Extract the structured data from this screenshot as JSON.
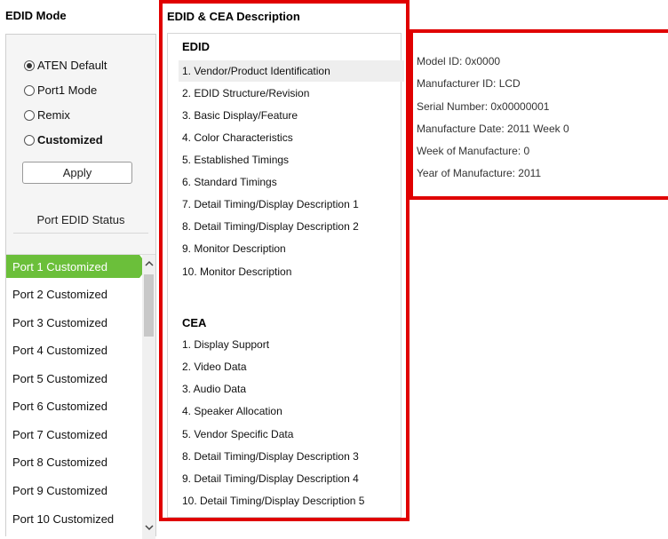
{
  "left": {
    "title": "EDID Mode",
    "modes": [
      {
        "label": "ATEN Default",
        "checked": true,
        "bold": false
      },
      {
        "label": "Port1 Mode",
        "checked": false,
        "bold": false
      },
      {
        "label": "Remix",
        "checked": false,
        "bold": false
      },
      {
        "label": "Customized",
        "checked": false,
        "bold": true
      }
    ],
    "apply_label": "Apply",
    "port_status_title": "Port EDID Status",
    "ports": [
      "Port 1  Customized",
      "Port 2  Customized",
      "Port 3  Customized",
      "Port 4  Customized",
      "Port 5  Customized",
      "Port 6  Customized",
      "Port 7  Customized",
      "Port 8  Customized",
      "Port 9  Customized",
      "Port 10  Customized"
    ],
    "active_port": 0
  },
  "middle": {
    "title": "EDID & CEA Description",
    "edid_heading": "EDID",
    "edid_items": [
      "1.  Vendor/Product Identification",
      "2.  EDID Structure/Revision",
      "3.  Basic Display/Feature",
      "4.  Color Characteristics",
      "5.  Established Timings",
      "6.  Standard Timings",
      "7.  Detail Timing/Display Description 1",
      "8.  Detail Timing/Display Description 2",
      "9.  Monitor Description",
      "10.  Monitor Description"
    ],
    "selected_item": 0,
    "cea_heading": "CEA",
    "cea_items": [
      "1.  Display Support",
      "2.  Video Data",
      "3.  Audio Data",
      "4.  Speaker Allocation",
      "5.  Vendor Specific Data",
      "8.  Detail Timing/Display Description 3",
      "9.  Detail Timing/Display Description 4",
      "10.  Detail Timing/Display Description 5"
    ]
  },
  "right": {
    "lines": [
      "Model ID: 0x0000",
      "Manufacturer ID: LCD",
      "Serial Number: 0x00000001",
      "Manufacture Date: 2011 Week 0",
      "Week of Manufacture: 0",
      "Year of Manufacture: 2011"
    ]
  },
  "colors": {
    "highlight_border": "#e00000",
    "active_port": "#6bbf3a"
  },
  "icons": [
    "radio-checked-icon",
    "radio-unchecked-icon",
    "chevron-up-icon",
    "chevron-down-icon"
  ]
}
